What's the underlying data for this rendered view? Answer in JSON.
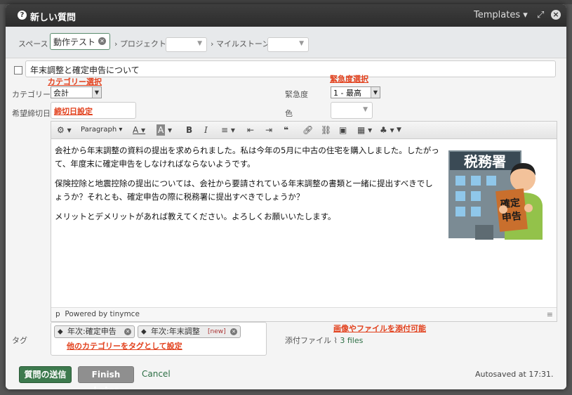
{
  "dialog": {
    "title": "新しい質問",
    "templates_label": "Templates ▾",
    "expand_icon": "⤢",
    "close_icon": "×"
  },
  "spacebar": {
    "space_label": "スペース",
    "space_value": "動作テスト",
    "project_label": "› プロジェクト",
    "milestone_label": "› マイルストーン"
  },
  "subject": {
    "value": "年末調整と確定申告について"
  },
  "fields": {
    "category_label": "カテゴリー",
    "category_value": "会計",
    "urgency_label": "緊急度",
    "urgency_value": "1 - 最高",
    "deadline_label": "希望締切日",
    "color_label": "色"
  },
  "annotations": {
    "category": "カテゴリー選択",
    "urgency": "緊急度選択",
    "deadline": "締切日設定",
    "tags": "他のカテゴリーをタグとして設定",
    "attach": "画像やファイルを添付可能"
  },
  "editor": {
    "format_select": "Paragraph",
    "paragraphs": [
      "会社から年末調整の資料の提出を求められました。私は今年の5月に中古の住宅を購入しました。したがって、年度末に確定申告をしなければならないようです。",
      "保険控除と地震控除の提出については、会社から要請されている年末調整の書類と一緒に提出すべきでしょうか？それとも、確定申告の際に税務署に提出すべきでしょうか？",
      "メリットとデメリットがあれば教えてください。よろしくお願いいたします。"
    ],
    "status_path": "p",
    "powered_by": "Powered by tinymce",
    "illustration": {
      "sign_text": "税務署",
      "paper_text_1": "確定",
      "paper_text_2": "申告"
    }
  },
  "tags": {
    "label": "タグ",
    "items": [
      {
        "label": "年次:確定申告",
        "new": ""
      },
      {
        "label": "年次:年末調整",
        "new": "[new]"
      }
    ]
  },
  "attachments": {
    "label": "添付ファイル",
    "files": "3 files"
  },
  "footer": {
    "send_label": "質問の送信",
    "later_label": "Finish Later",
    "cancel_label": "Cancel",
    "autosave": "Autosaved at 17:31."
  }
}
